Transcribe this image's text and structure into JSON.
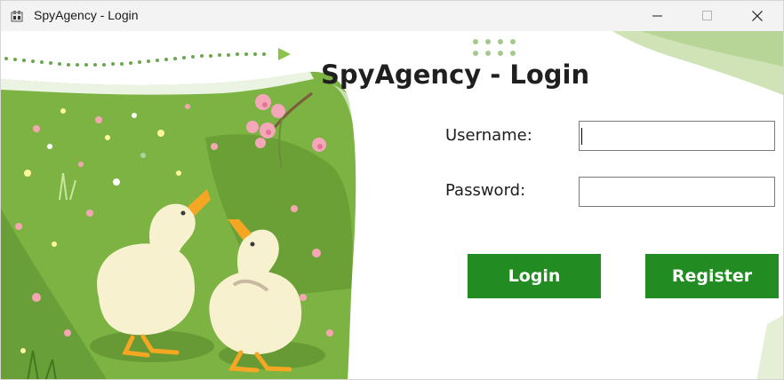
{
  "window": {
    "title": "SpyAgency - Login",
    "app_icon": "app-icon",
    "controls": {
      "minimize_icon": "minimize-icon",
      "maximize_icon": "maximize-icon",
      "close_icon": "close-icon"
    }
  },
  "login": {
    "heading": "SpyAgency - Login",
    "username_label": "Username:",
    "username_value": "",
    "password_label": "Password:",
    "password_value": "",
    "login_button": "Login",
    "register_button": "Register"
  },
  "colors": {
    "button_bg": "#228b22",
    "button_text": "#ffffff",
    "titlebar_bg": "#f3f3f3",
    "grass": "#7cb342"
  }
}
